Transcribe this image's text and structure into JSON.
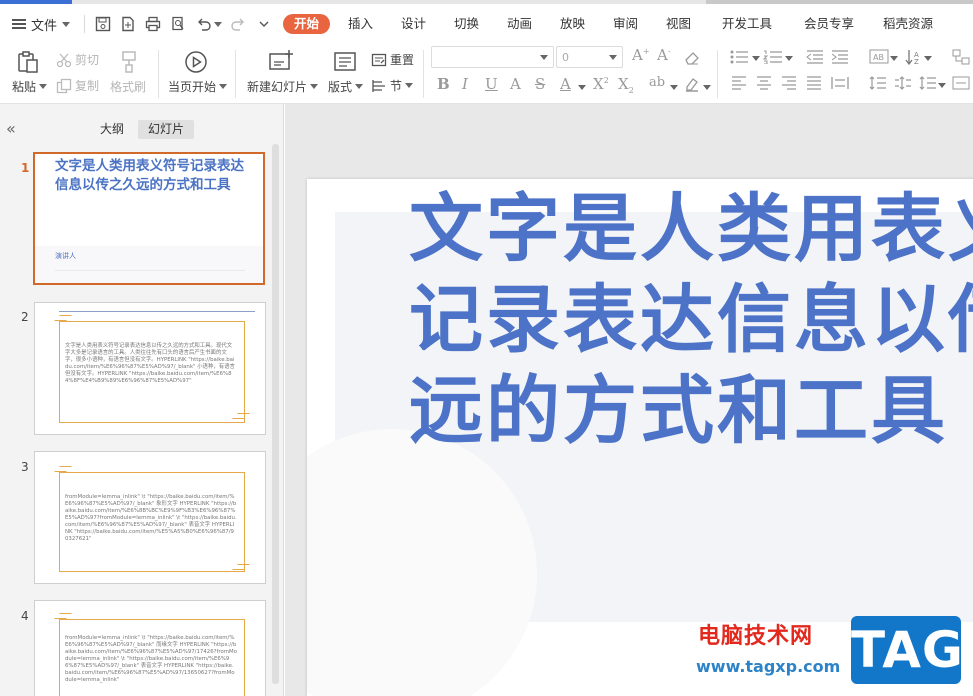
{
  "menubar": {
    "file_label": "文件",
    "tabs": [
      "开始",
      "插入",
      "设计",
      "切换",
      "动画",
      "放映",
      "审阅",
      "视图",
      "开发工具",
      "会员专享",
      "稻壳资源"
    ],
    "active_tab": "开始"
  },
  "toolbar": {
    "paste": "粘贴",
    "cut": "剪切",
    "copy": "复制",
    "format_painter": "格式刷",
    "play_from_current": "当页开始",
    "new_slide": "新建幻灯片",
    "layout": "版式",
    "reset": "重置",
    "section": "节",
    "font_size_value": "0"
  },
  "left_panel": {
    "tab_outline": "大纲",
    "tab_slides": "幻灯片",
    "slides": [
      {
        "num": "1",
        "title": "文字是人类用表义符号记录表达信息以传之久远的方式和工具",
        "presenter": "演讲人"
      },
      {
        "num": "2",
        "text": "文字是人类用表义符号记录表达信息以传之久远的方式和工具。现代文字大多是记录语言的工具。人类往往先有口头的语言后产生书面的文字，很多小语种，有语言但没有文字。HYPERLINK \"https://baike.baidu.com/item/%E6%96%87%E5%AD%97/_blank\" 小语种，有语言但没有文字。HYPERLINK \"https://baike.baidu.com/item/%E6%84%8F%E4%B9%89%E6%96%87%E5%AD%97\""
      },
      {
        "num": "3",
        "text": "fromModule=lemma_inlink\" \\t \"https://baike.baidu.com/item/%E6%96%87%E5%AD%97/_blank\" 象形文字 HYPERLINK \"https://baike.baidu.com/item/%E6%8B%BC%E9%9F%B3%E6%96%87%E5%AD%97?fromModule=lemma_inlink\" \\t \"https://baike.baidu.com/item/%E6%96%87%E5%AD%97/_blank\" 表音文字 HYPERLINK \"https://baike.baidu.com/item/%E5%A5%B0%E6%96%87/90327621\""
      },
      {
        "num": "4",
        "text": "fromModule=lemma_inlink\" \\t \"https://baike.baidu.com/item/%E6%96%87%E5%AD%97/_blank\" 而缘文字 HYPERLINK \"https://baike.baidu.com/item/%E6%96%87%E5%AD%97/17426?fromModule=lemma_inlink\" \\t \"https://baike.baidu.com/item/%E6%96%87%E5%AD%97/_blank\" 表音文字 HYPERLINK \"https://baike.baidu.com/item/%E6%96%87%E5%AD%97/13650627?fromModule=lemma_inlink\""
      }
    ]
  },
  "canvas": {
    "title_lines": [
      "文字是人类用表义符号",
      "记录表达信息以传之久",
      "远的方式和工具"
    ]
  },
  "watermark": {
    "site_name": "电脑技术网",
    "url": "www.tagxp.com",
    "tag": "TAG"
  },
  "colors": {
    "accent": "#e8653f",
    "title_blue": "#4c73c7",
    "slide_frame": "#e6a94a",
    "selected_border": "#d0692a"
  }
}
